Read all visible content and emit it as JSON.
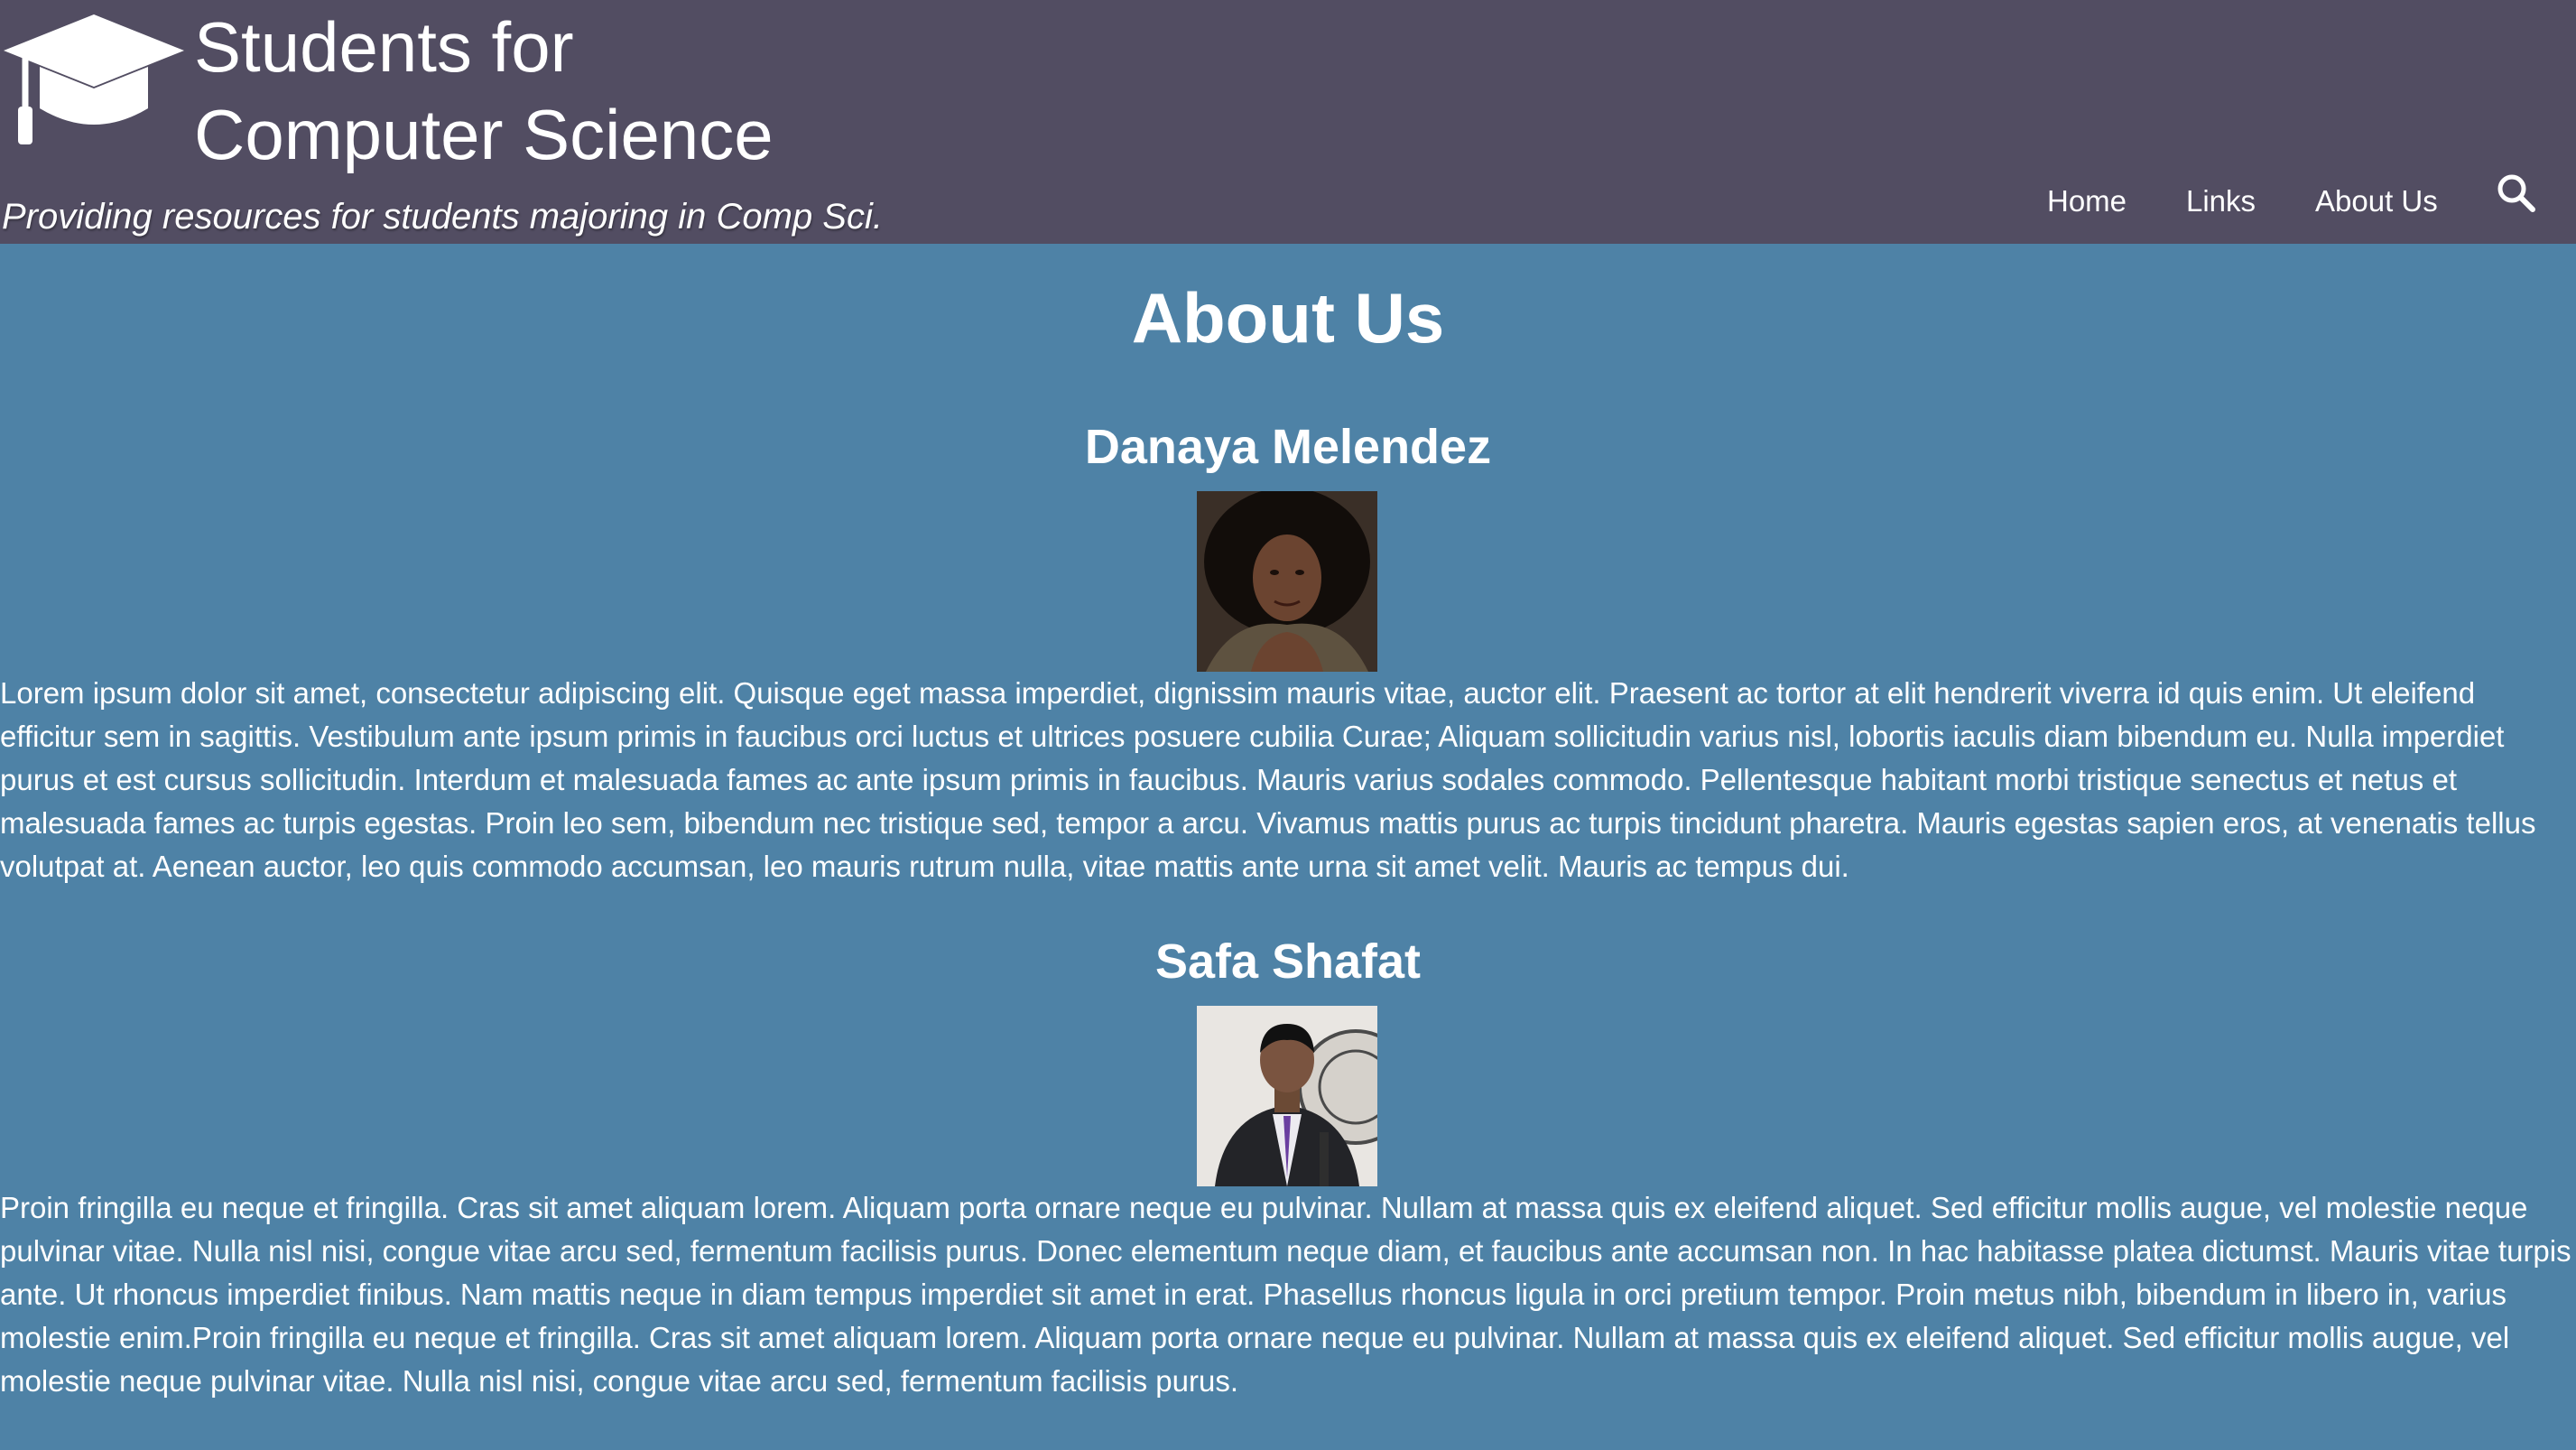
{
  "header": {
    "title_line1": "Students for",
    "title_line2": "Computer Science",
    "tagline": "Providing resources for students majoring in Comp Sci."
  },
  "nav": {
    "items": [
      {
        "label": "Home"
      },
      {
        "label": "Links"
      },
      {
        "label": "About Us"
      }
    ],
    "search_icon": "search-icon"
  },
  "main": {
    "title": "About Us",
    "members": [
      {
        "name": "Danaya Melendez",
        "bio": "Lorem ipsum dolor sit amet, consectetur adipiscing elit. Quisque eget massa imperdiet, dignissim mauris vitae, auctor elit. Praesent ac tortor at elit hendrerit viverra id quis enim. Ut eleifend efficitur sem in sagittis. Vestibulum ante ipsum primis in faucibus orci luctus et ultrices posuere cubilia Curae; Aliquam sollicitudin varius nisl, lobortis iaculis diam bibendum eu. Nulla imperdiet purus et est cursus sollicitudin. Interdum et malesuada fames ac ante ipsum primis in faucibus. Mauris varius sodales commodo. Pellentesque habitant morbi tristique senectus et netus et malesuada fames ac turpis egestas. Proin leo sem, bibendum nec tristique sed, tempor a arcu. Vivamus mattis purus ac turpis tincidunt pharetra. Mauris egestas sapien eros, at venenatis tellus volutpat at. Aenean auctor, leo quis commodo accumsan, leo mauris rutrum nulla, vitae mattis ante urna sit amet velit. Mauris ac tempus dui."
      },
      {
        "name": "Safa Shafat",
        "bio": "Proin fringilla eu neque et fringilla. Cras sit amet aliquam lorem. Aliquam porta ornare neque eu pulvinar. Nullam at massa quis ex eleifend aliquet. Sed efficitur mollis augue, vel molestie neque pulvinar vitae. Nulla nisl nisi, congue vitae arcu sed, fermentum facilisis purus. Donec elementum neque diam, et faucibus ante accumsan non. In hac habitasse platea dictumst. Mauris vitae turpis ante. Ut rhoncus imperdiet finibus. Nam mattis neque in diam tempus imperdiet sit amet in erat. Phasellus rhoncus ligula in orci pretium tempor. Proin metus nibh, bibendum in libero in, varius molestie enim.Proin fringilla eu neque et fringilla. Cras sit amet aliquam lorem. Aliquam porta ornare neque eu pulvinar. Nullam at massa quis ex eleifend aliquet. Sed efficitur mollis augue, vel molestie neque pulvinar vitae. Nulla nisl nisi, congue vitae arcu sed, fermentum facilisis purus."
      }
    ]
  },
  "colors": {
    "header_bg": "#524d62",
    "page_bg": "#4e82a6",
    "text": "#ffffff"
  }
}
